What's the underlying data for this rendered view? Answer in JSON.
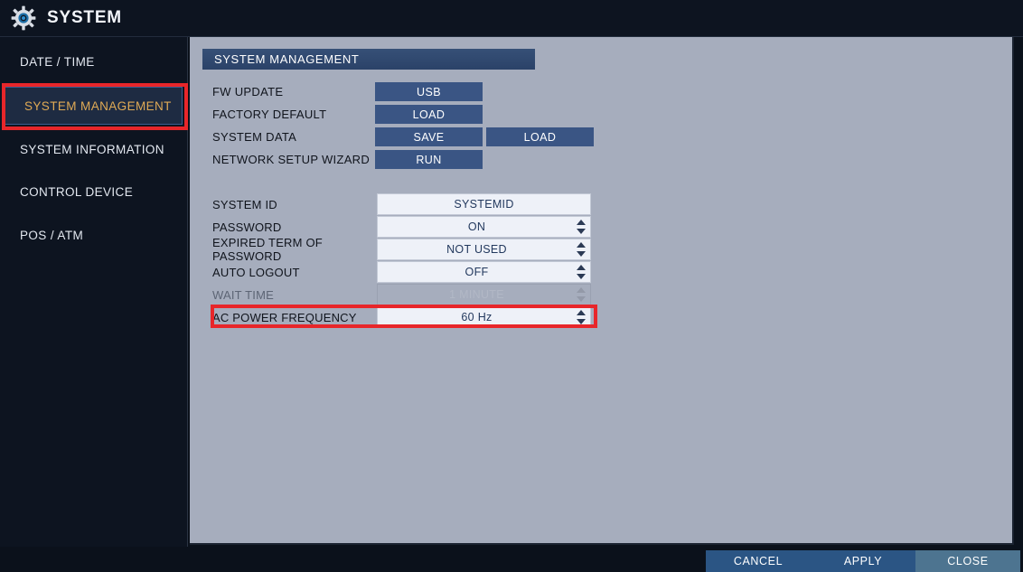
{
  "titlebar": {
    "icon": "gear-icon",
    "title": "SYSTEM"
  },
  "sidebar": {
    "items": [
      {
        "label": "DATE / TIME",
        "selected": false
      },
      {
        "label": "SYSTEM MANAGEMENT",
        "selected": true
      },
      {
        "label": "SYSTEM INFORMATION",
        "selected": false
      },
      {
        "label": "CONTROL DEVICE",
        "selected": false
      },
      {
        "label": "POS / ATM",
        "selected": false
      }
    ]
  },
  "panel": {
    "section_title": "SYSTEM MANAGEMENT",
    "action_rows": [
      {
        "label": "FW UPDATE",
        "primary": "USB",
        "secondary": null
      },
      {
        "label": "FACTORY DEFAULT",
        "primary": "LOAD",
        "secondary": null
      },
      {
        "label": "SYSTEM DATA",
        "primary": "SAVE",
        "secondary": "LOAD"
      },
      {
        "label": "NETWORK SETUP WIZARD",
        "primary": "RUN",
        "secondary": null
      }
    ],
    "setting_rows": [
      {
        "label": "SYSTEM ID",
        "value": "SYSTEMID",
        "stepper": false,
        "disabled": false
      },
      {
        "label": "PASSWORD",
        "value": "ON",
        "stepper": true,
        "disabled": false
      },
      {
        "label": "EXPIRED TERM OF PASSWORD",
        "value": "NOT USED",
        "stepper": true,
        "disabled": false
      },
      {
        "label": "AUTO LOGOUT",
        "value": "OFF",
        "stepper": true,
        "disabled": false
      },
      {
        "label": "WAIT TIME",
        "value": "1 MINUTE",
        "stepper": true,
        "disabled": true
      },
      {
        "label": "AC POWER FREQUENCY",
        "value": "60 Hz",
        "stepper": true,
        "disabled": false
      }
    ]
  },
  "bottombar": {
    "cancel_label": "CANCEL",
    "apply_label": "APPLY",
    "close_label": "CLOSE"
  },
  "annotations": {
    "highlight_color": "#e8262a",
    "targets": [
      "sidebar-item-system-management",
      "setting-row-ac-power-frequency"
    ]
  },
  "colors": {
    "panel_bg": "#a6adbd",
    "chrome_bg": "#0d1420",
    "accent_navy": "#3a5584",
    "selected_text": "#e0aa55",
    "field_bg": "#eef1f8"
  }
}
